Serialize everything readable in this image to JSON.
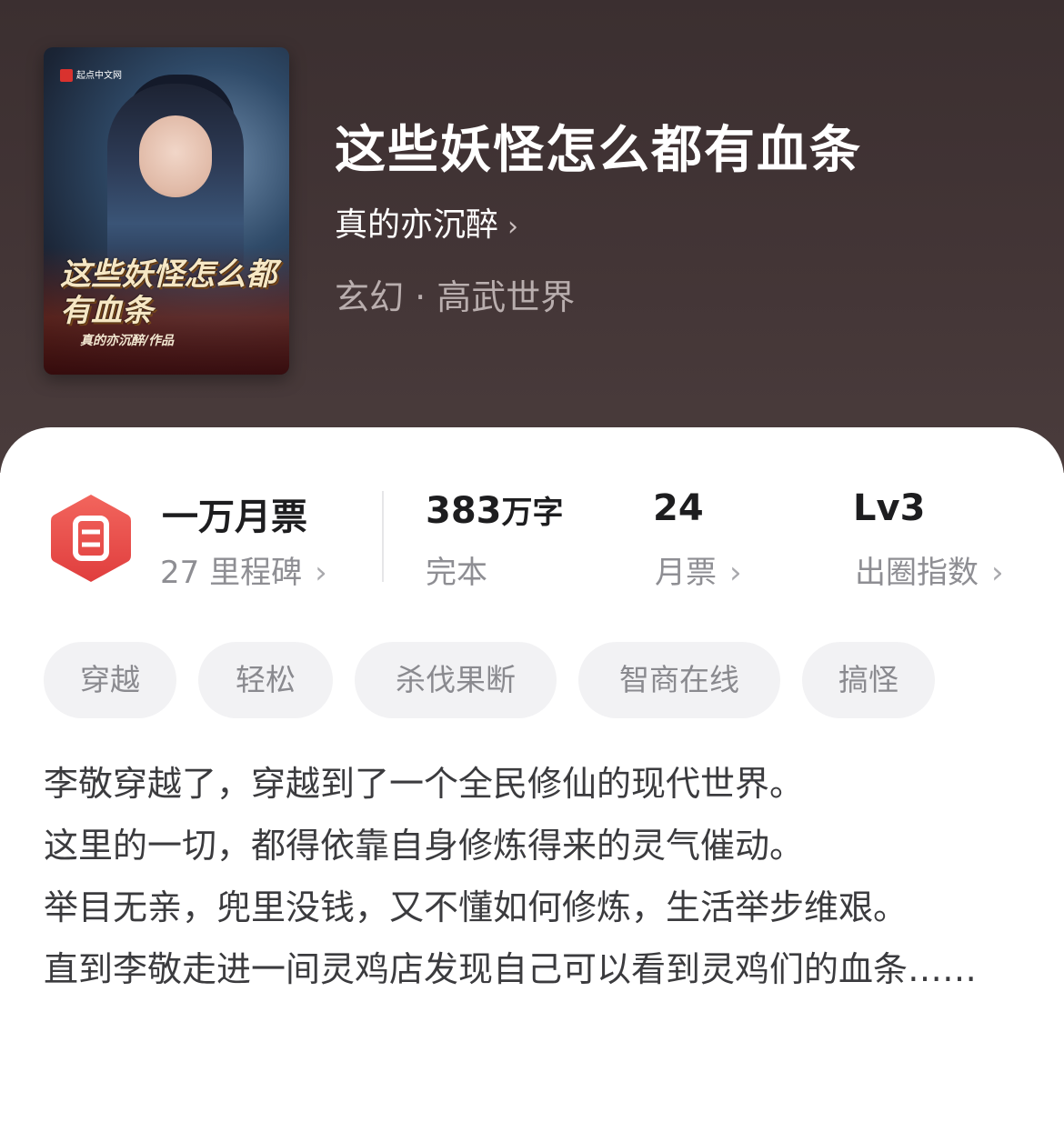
{
  "book": {
    "title": "这些妖怪怎么都有血条",
    "author": "真的亦沉醉",
    "author_chevron": "›",
    "genre": "玄幻 · 高武世界",
    "cover": {
      "logo_text": "起点中文网",
      "title_text": "这些妖怪怎么都有血条",
      "byline": "真的亦沉醉/作品"
    }
  },
  "stats": {
    "milestone": {
      "main": "一万月票",
      "sub": "27 里程碑",
      "chevron": "›"
    },
    "words": {
      "main_number": "383",
      "main_unit": "万字",
      "sub": "完本"
    },
    "monthly_tickets": {
      "main": "24",
      "sub": "月票",
      "chevron": "›"
    },
    "popularity": {
      "main": "Lv3",
      "sub": "出圈指数",
      "chevron": "›"
    }
  },
  "tags": [
    "穿越",
    "轻松",
    "杀伐果断",
    "智商在线",
    "搞怪"
  ],
  "description": [
    "李敬穿越了，穿越到了一个全民修仙的现代世界。",
    "这里的一切，都得依靠自身修炼得来的灵气催动。",
    "举目无亲，兜里没钱，又不懂如何修炼，生活举步维艰。",
    "直到李敬走进一间灵鸡店发现自己可以看到灵鸡们的血条……"
  ],
  "colors": {
    "hero_bg": "#433536",
    "badge_red": "#ea4b4b",
    "tag_bg": "#f2f2f4"
  }
}
